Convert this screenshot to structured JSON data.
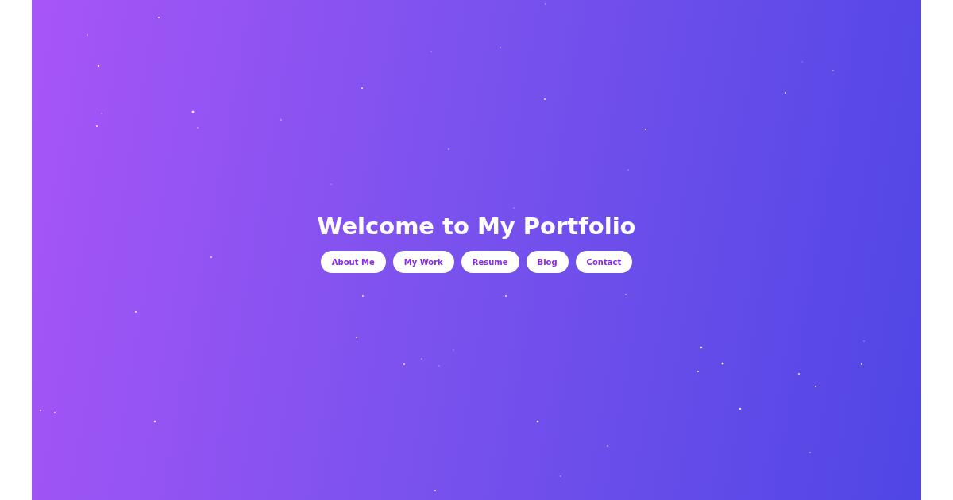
{
  "hero": {
    "title": "Welcome to My Portfolio"
  },
  "nav_buttons": [
    "About Me",
    "My Work",
    "Resume",
    "Blog",
    "Contact"
  ]
}
